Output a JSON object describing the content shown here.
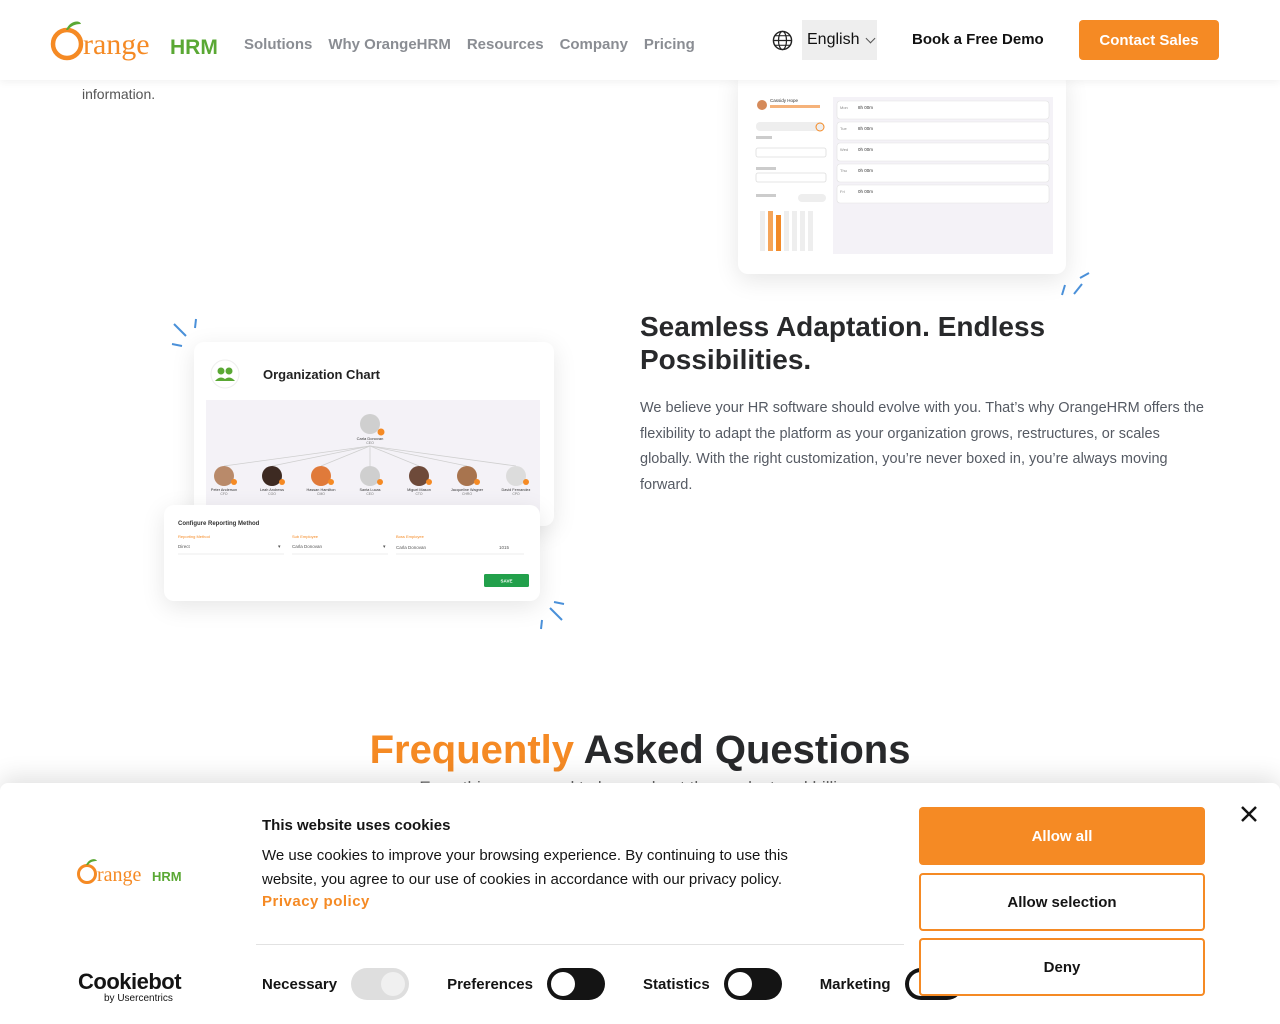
{
  "header": {
    "logo_text_orange": "range",
    "logo_text_hrm": "HRM",
    "nav": [
      "Solutions",
      "Why OrangeHRM",
      "Resources",
      "Company",
      "Pricing"
    ],
    "language": "English",
    "demo_label": "Book a Free Demo",
    "contact_label": "Contact Sales"
  },
  "section_info": {
    "tail_text": "information."
  },
  "timesheet_preview": {
    "employee": "Cassidy Hope",
    "rows": [
      "Mon",
      "Tue",
      "Wed",
      "Thu",
      "Fri"
    ],
    "hours": [
      "8h 00m",
      "8h 00m",
      "0h 00m",
      "0h 00m",
      "0h 00m"
    ]
  },
  "org_preview": {
    "title": "Organization Chart",
    "top_name": "Carla Donovan",
    "top_role": "CEO",
    "people": [
      {
        "name": "Peter Anderson",
        "role": "CFO"
      },
      {
        "name": "Leah Andrews",
        "role": "COO"
      },
      {
        "name": "Hassan Hamilton",
        "role": "CMO"
      },
      {
        "name": "Santa Lucas",
        "role": "CEO"
      },
      {
        "name": "Miguel Mason",
        "role": "CTO"
      },
      {
        "name": "Jacqueline Wagner",
        "role": "CHRO"
      },
      {
        "name": "David Fernandez",
        "role": "CPO"
      }
    ],
    "reporting_title": "Configure Reporting Method",
    "reporting_labels": [
      "Reporting Method",
      "Sub Employee",
      "Boss Employee"
    ],
    "reporting_values": [
      "Direct",
      "Carla Donovan",
      "Carla Donovan"
    ],
    "reporting_id": "1015",
    "save_label": "SAVE"
  },
  "feature": {
    "title": "Seamless Adaptation. Endless Possibilities.",
    "text": "We believe your HR software should evolve with you. That’s why OrangeHRM offers the flexibility to adapt the platform as your organization grows, restructures, or scales globally. With the right customization, you’re never boxed in, you’re always moving forward."
  },
  "faq": {
    "title_accent": "Frequently",
    "title_rest": " Asked Questions",
    "subtitle": "Everything you need to know about the product and billing."
  },
  "cookie": {
    "logo_text_orange": "range",
    "logo_text_hrm": "HRM",
    "title": "This website uses cookies",
    "text": "We use cookies to improve your browsing experience. By continuing to use this website, you agree to our use of cookies in accordance with our privacy policy.",
    "link": "Privacy policy",
    "toggles": [
      {
        "label": "Necessary",
        "state": "disabled-on"
      },
      {
        "label": "Preferences",
        "state": "off"
      },
      {
        "label": "Statistics",
        "state": "off"
      },
      {
        "label": "Marketing",
        "state": "off"
      }
    ],
    "buttons": {
      "allow_all": "Allow all",
      "allow_selection": "Allow selection",
      "deny": "Deny"
    },
    "brand_name": "Cookiebot",
    "brand_by": "by Usercentrics"
  },
  "colors": {
    "accent": "#f58a24",
    "green": "#5aa834",
    "text_dark": "#28292b"
  }
}
